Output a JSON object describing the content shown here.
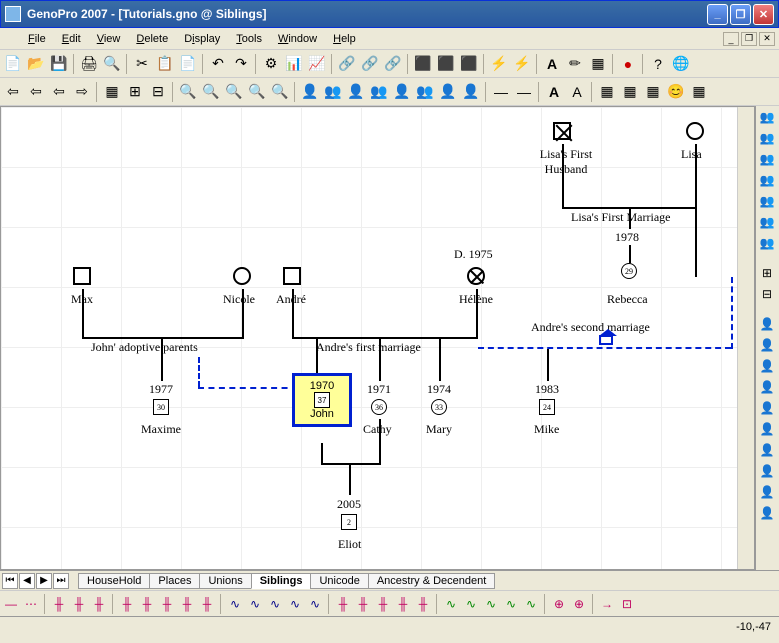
{
  "window": {
    "title": "GenoPro 2007 - [Tutorials.gno @ Siblings]"
  },
  "menu": {
    "file": "File",
    "edit": "Edit",
    "view": "View",
    "delete": "Delete",
    "display": "Display",
    "tools": "Tools",
    "window": "Window",
    "help": "Help"
  },
  "people": {
    "lisa_husband": "Lisa's First\nHusband",
    "lisa": "Lisa",
    "max": "Max",
    "nicole": "Nicole",
    "andre": "André",
    "helene": "Hélène",
    "helene_death": "D. 1975",
    "rebecca": "Rebecca",
    "rebecca_age": "29",
    "maxime": "Maxime",
    "maxime_year": "1977",
    "maxime_age": "30",
    "john": "John",
    "john_year": "1970",
    "john_age": "37",
    "cathy": "Cathy",
    "cathy_year": "1971",
    "cathy_age": "36",
    "mary": "Mary",
    "mary_year": "1974",
    "mary_age": "33",
    "mike": "Mike",
    "mike_year": "1983",
    "mike_age": "24",
    "eliot": "Eliot",
    "eliot_year": "2005",
    "eliot_age": "2"
  },
  "marriages": {
    "lisa_first": "Lisa's First Marriage",
    "lisa_first_year": "1978",
    "john_adoptive": "John' adoptive parents",
    "andre_first": "Andre's first marriage",
    "andre_second": "Andre's second marriage"
  },
  "tabs": [
    "HouseHold",
    "Places",
    "Unions",
    "Siblings",
    "Unicode",
    "Ancestry & Decendent"
  ],
  "active_tab": "Siblings",
  "status": {
    "coords": "-10,-47"
  }
}
